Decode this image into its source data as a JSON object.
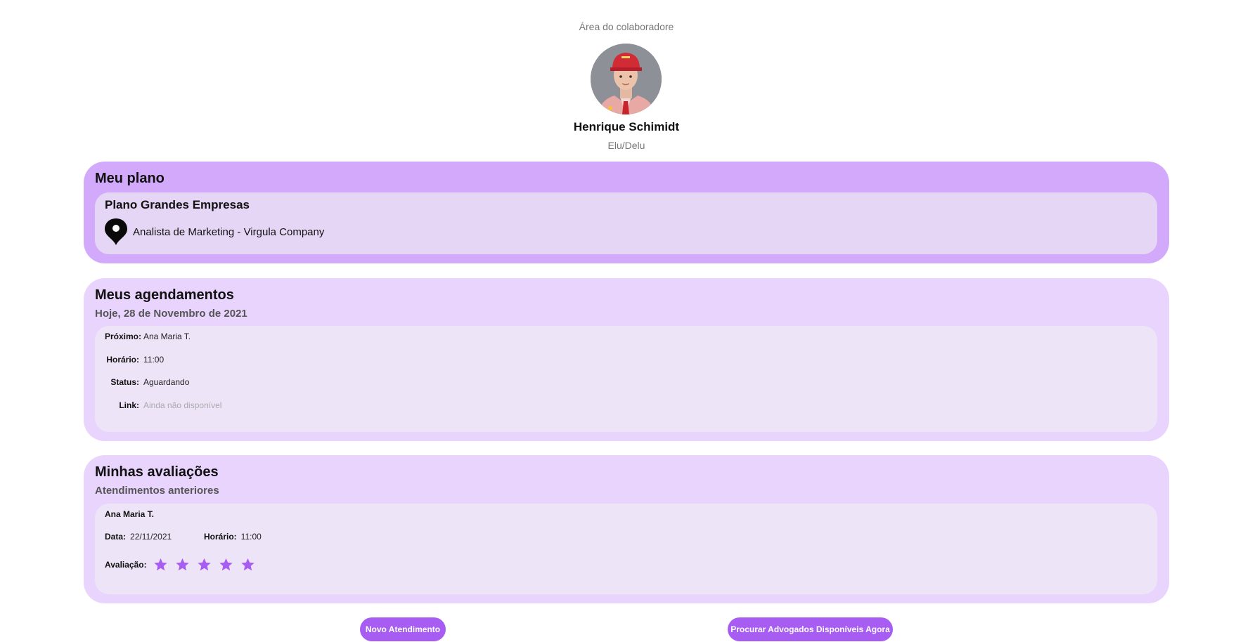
{
  "header": {
    "area_label": "Área do colaboradore",
    "name": "Henrique Schimidt",
    "pronouns": "Elu/Delu"
  },
  "plan": {
    "title": "Meu plano",
    "plan_name": "Plano Grandes Empresas",
    "role": "Analista de Marketing - Virgula Company",
    "icon": "location-pin-icon"
  },
  "schedule": {
    "title": "Meus agendamentos",
    "date": "Hoje, 28 de Novembro de 2021",
    "rows": [
      {
        "label": "Próximo:",
        "value": "Ana Maria T."
      },
      {
        "label": "Horário:",
        "value": "11:00"
      },
      {
        "label": "Status:",
        "value": "Aguardando"
      },
      {
        "label": "Link:",
        "value": "Ainda não disponível"
      }
    ]
  },
  "evaluations": {
    "title": "Minhas avaliações",
    "subtitle": "Atendimentos anteriores",
    "item": {
      "person": "Ana Maria T.",
      "date_label": "Data:",
      "date_value": "22/11/2021",
      "time_label": "Horário:",
      "time_value": "11:00",
      "rating_label": "Avaliação:",
      "rating": 5,
      "rating_max": 5
    }
  },
  "actions": {
    "new_label": "Novo Atendimento",
    "search_label": "Procurar Advogados Disponíveis Agora"
  },
  "colors": {
    "accent": "#a75cf2",
    "plan_card": "#d2a9fb",
    "card": "#e9d4fd",
    "star": "#a75cf2"
  }
}
